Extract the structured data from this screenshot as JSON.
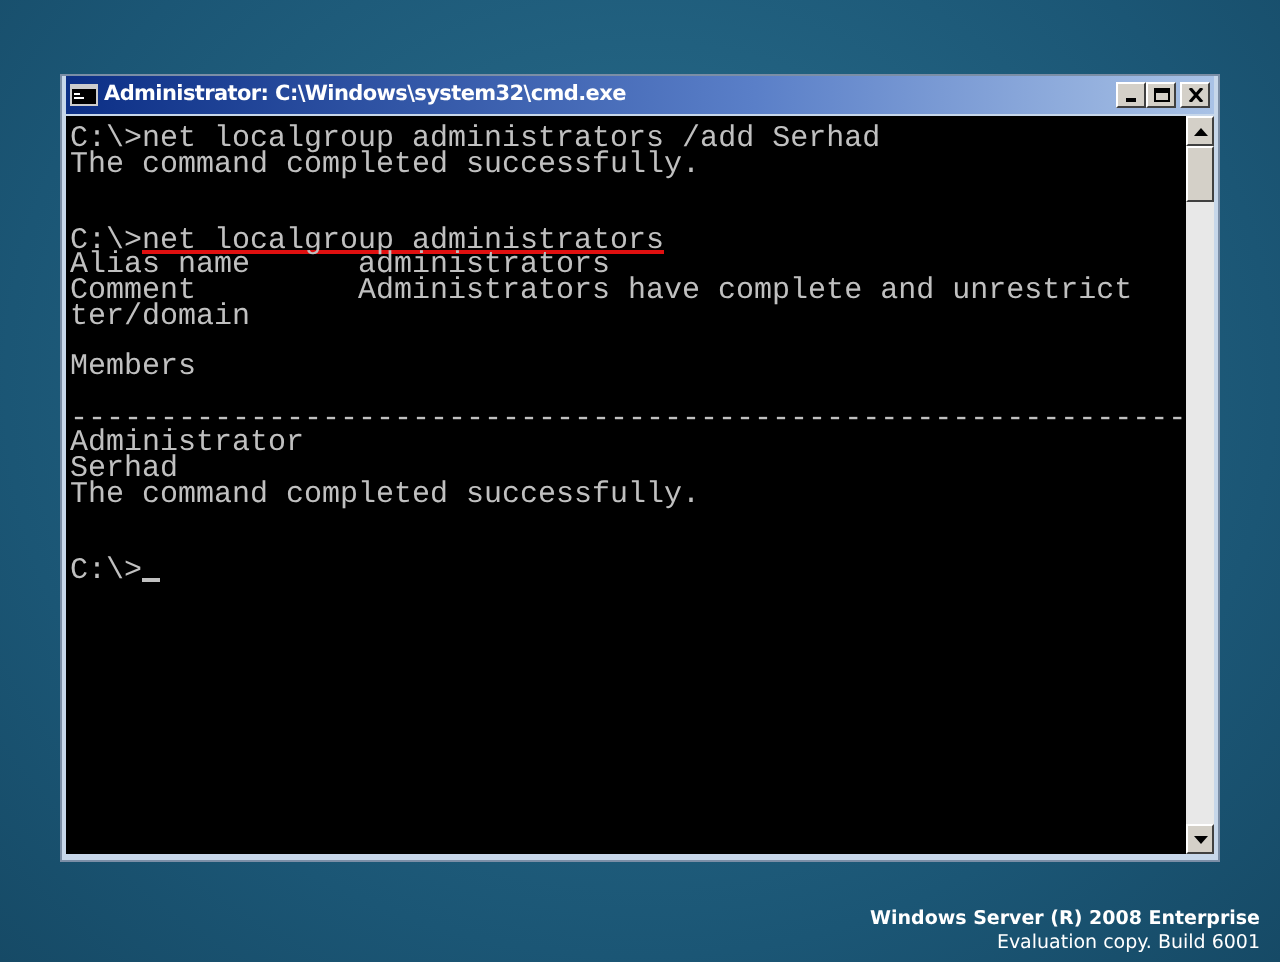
{
  "window": {
    "title": "Administrator: C:\\Windows\\system32\\cmd.exe"
  },
  "console": {
    "lines": [
      {
        "kind": "text",
        "prompt": "C:\\>",
        "text": "net localgroup administrators /add Serhad"
      },
      {
        "kind": "text",
        "text": "The command completed successfully."
      },
      {
        "kind": "blank"
      },
      {
        "kind": "blank"
      },
      {
        "kind": "text",
        "prompt": "C:\\>",
        "text": "net localgroup administrators",
        "underlined": true
      },
      {
        "kind": "text",
        "text": "Alias name      administrators"
      },
      {
        "kind": "text",
        "text": "Comment         Administrators have complete and unrestrict"
      },
      {
        "kind": "text",
        "text": "ter/domain"
      },
      {
        "kind": "blank"
      },
      {
        "kind": "text",
        "text": "Members"
      },
      {
        "kind": "blank"
      },
      {
        "kind": "text",
        "text": "--------------------------------------------------------------"
      },
      {
        "kind": "text",
        "text": "Administrator"
      },
      {
        "kind": "text",
        "text": "Serhad"
      },
      {
        "kind": "text",
        "text": "The command completed successfully."
      },
      {
        "kind": "blank"
      },
      {
        "kind": "blank"
      },
      {
        "kind": "text",
        "prompt": "C:\\>",
        "cursor": true
      }
    ]
  },
  "desktop": {
    "branding": [
      "Windows Server (R) 2008 Enterprise",
      "Evaluation copy. Build 6001"
    ]
  }
}
